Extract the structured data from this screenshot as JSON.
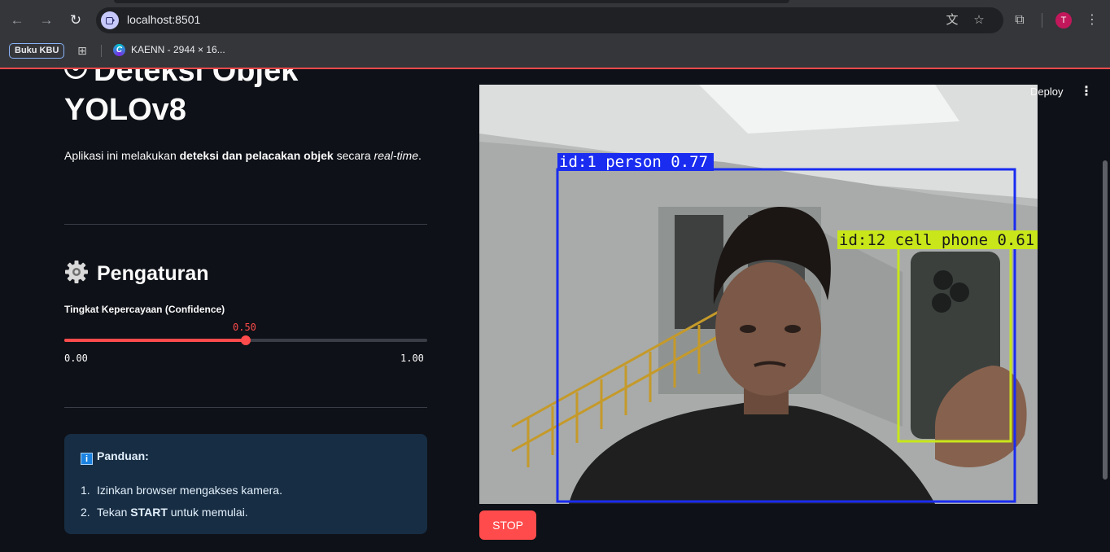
{
  "browser": {
    "url": "localhost:8501",
    "bookmarks": [
      {
        "label": "Buku KBU"
      },
      {
        "label": "KAENN - 2944 × 16..."
      }
    ],
    "profile_initial": "T"
  },
  "header": {
    "deploy_label": "Deploy"
  },
  "sidebar": {
    "title_line1": "Deteksi Objek",
    "title_line2": "YOLOv8",
    "desc_pre": "Aplikasi ini melakukan ",
    "desc_bold": "deteksi dan pelacakan objek",
    "desc_mid": " secara ",
    "desc_italic": "real-time",
    "desc_end": ".",
    "settings_title": "Pengaturan",
    "slider": {
      "label": "Tingkat Kepercayaan (Confidence)",
      "value": 0.5,
      "value_label": "0.50",
      "min_label": "0.00",
      "max_label": "1.00"
    },
    "guide": {
      "title": "Panduan:",
      "step1_num": "1.",
      "step1_text": "Izinkan browser mengakses kamera.",
      "step2_num": "2.",
      "step2_pre": "Tekan ",
      "step2_bold": "START",
      "step2_post": " untuk memulai."
    }
  },
  "video": {
    "detections": [
      {
        "label": "id:1 person 0.77",
        "color": "#1a2cf0"
      },
      {
        "label": "id:12 cell phone 0.61",
        "color": "#c8e61a"
      }
    ],
    "stop_label": "STOP"
  }
}
